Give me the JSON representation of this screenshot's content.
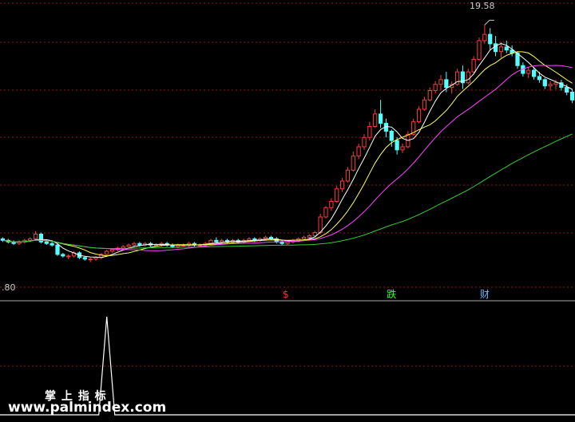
{
  "chart_data": {
    "type": "candlestick",
    "y_price_labels": {
      "low": ".80",
      "high": "19.58"
    },
    "ylim": [
      2.8,
      21.0
    ],
    "x_count": 120,
    "candles": [
      [
        5.9,
        6.0,
        5.7,
        5.8
      ],
      [
        5.8,
        5.9,
        5.6,
        5.7
      ],
      [
        5.7,
        5.8,
        5.5,
        5.6
      ],
      [
        5.6,
        5.8,
        5.5,
        5.7
      ],
      [
        5.7,
        5.9,
        5.6,
        5.8
      ],
      [
        5.8,
        6.0,
        5.7,
        5.9
      ],
      [
        5.9,
        6.4,
        5.8,
        6.2
      ],
      [
        6.2,
        6.3,
        5.6,
        5.7
      ],
      [
        5.7,
        5.8,
        5.5,
        5.6
      ],
      [
        5.6,
        5.8,
        5.4,
        5.5
      ],
      [
        5.5,
        5.6,
        4.8,
        4.9
      ],
      [
        4.9,
        5.0,
        4.7,
        4.8
      ],
      [
        4.8,
        4.9,
        4.6,
        4.8
      ],
      [
        4.8,
        5.1,
        4.7,
        5.0
      ],
      [
        5.0,
        5.1,
        4.6,
        4.7
      ],
      [
        4.7,
        4.8,
        4.5,
        4.6
      ],
      [
        4.6,
        4.7,
        4.4,
        4.6
      ],
      [
        4.6,
        4.8,
        4.5,
        4.7
      ],
      [
        4.7,
        5.0,
        4.6,
        4.9
      ],
      [
        4.9,
        5.2,
        4.8,
        5.1
      ],
      [
        5.1,
        5.3,
        5.0,
        5.2
      ],
      [
        5.2,
        5.4,
        5.1,
        5.3
      ],
      [
        5.3,
        5.5,
        5.2,
        5.4
      ],
      [
        5.4,
        5.6,
        5.3,
        5.5
      ],
      [
        5.5,
        5.7,
        5.4,
        5.6
      ],
      [
        5.6,
        5.7,
        5.4,
        5.5
      ],
      [
        5.5,
        5.7,
        5.4,
        5.6
      ],
      [
        5.6,
        5.7,
        5.4,
        5.5
      ],
      [
        5.5,
        5.6,
        5.4,
        5.5
      ],
      [
        5.5,
        5.7,
        5.4,
        5.6
      ],
      [
        5.6,
        5.7,
        5.4,
        5.5
      ],
      [
        5.5,
        5.6,
        5.3,
        5.4
      ],
      [
        5.4,
        5.6,
        5.3,
        5.5
      ],
      [
        5.5,
        5.6,
        5.4,
        5.5
      ],
      [
        5.5,
        5.7,
        5.4,
        5.6
      ],
      [
        5.6,
        5.7,
        5.4,
        5.5
      ],
      [
        5.5,
        5.6,
        5.4,
        5.5
      ],
      [
        5.5,
        5.7,
        5.4,
        5.6
      ],
      [
        5.6,
        5.9,
        5.5,
        5.8
      ],
      [
        5.8,
        6.0,
        5.6,
        5.7
      ],
      [
        5.7,
        5.9,
        5.6,
        5.8
      ],
      [
        5.8,
        5.9,
        5.6,
        5.7
      ],
      [
        5.7,
        5.9,
        5.6,
        5.8
      ],
      [
        5.8,
        5.9,
        5.6,
        5.7
      ],
      [
        5.7,
        5.9,
        5.6,
        5.8
      ],
      [
        5.8,
        6.0,
        5.7,
        5.9
      ],
      [
        5.9,
        6.0,
        5.7,
        5.8
      ],
      [
        5.8,
        6.0,
        5.7,
        5.9
      ],
      [
        5.9,
        6.1,
        5.8,
        6.0
      ],
      [
        6.0,
        6.1,
        5.8,
        5.9
      ],
      [
        5.9,
        6.0,
        5.6,
        5.7
      ],
      [
        5.7,
        5.8,
        5.5,
        5.6
      ],
      [
        5.6,
        5.8,
        5.5,
        5.7
      ],
      [
        5.7,
        5.9,
        5.6,
        5.8
      ],
      [
        5.8,
        6.0,
        5.7,
        5.9
      ],
      [
        5.9,
        6.1,
        5.8,
        6.0
      ],
      [
        6.0,
        6.2,
        5.9,
        6.1
      ],
      [
        6.1,
        6.4,
        6.0,
        6.3
      ],
      [
        6.3,
        7.5,
        6.2,
        7.3
      ],
      [
        7.3,
        8.0,
        7.2,
        7.9
      ],
      [
        7.9,
        8.5,
        7.7,
        8.3
      ],
      [
        8.3,
        9.3,
        8.2,
        9.1
      ],
      [
        9.1,
        9.8,
        8.9,
        9.6
      ],
      [
        9.6,
        10.5,
        9.5,
        10.3
      ],
      [
        10.3,
        11.5,
        10.2,
        11.2
      ],
      [
        11.2,
        12.0,
        11.0,
        11.8
      ],
      [
        11.8,
        12.6,
        11.6,
        12.4
      ],
      [
        12.4,
        13.4,
        12.2,
        13.1
      ],
      [
        13.1,
        14.2,
        13.0,
        13.9
      ],
      [
        13.9,
        14.8,
        13.0,
        13.3
      ],
      [
        13.3,
        13.6,
        12.4,
        12.8
      ],
      [
        12.8,
        12.9,
        11.8,
        12.2
      ],
      [
        12.2,
        12.4,
        11.3,
        11.6
      ],
      [
        11.6,
        12.0,
        11.4,
        11.8
      ],
      [
        11.8,
        12.8,
        11.7,
        12.6
      ],
      [
        12.6,
        13.6,
        12.5,
        13.4
      ],
      [
        13.4,
        14.4,
        13.3,
        14.2
      ],
      [
        14.2,
        15.0,
        14.1,
        14.8
      ],
      [
        14.8,
        15.6,
        14.7,
        15.4
      ],
      [
        15.4,
        16.0,
        15.2,
        15.8
      ],
      [
        15.8,
        16.4,
        15.4,
        16.1
      ],
      [
        16.1,
        16.6,
        15.3,
        15.6
      ],
      [
        15.6,
        16.0,
        15.2,
        15.8
      ],
      [
        15.8,
        16.8,
        15.7,
        16.6
      ],
      [
        16.6,
        17.0,
        15.5,
        15.9
      ],
      [
        15.9,
        16.8,
        15.8,
        16.6
      ],
      [
        16.6,
        17.6,
        16.5,
        17.4
      ],
      [
        17.4,
        18.8,
        17.3,
        18.6
      ],
      [
        18.6,
        19.6,
        18.4,
        19.0
      ],
      [
        19.0,
        19.4,
        18.0,
        18.4
      ],
      [
        18.4,
        18.9,
        17.6,
        17.9
      ],
      [
        17.9,
        18.5,
        17.5,
        18.2
      ],
      [
        18.2,
        18.6,
        17.8,
        18.0
      ],
      [
        18.0,
        18.3,
        17.6,
        17.8
      ],
      [
        17.8,
        17.9,
        16.8,
        17.0
      ],
      [
        17.0,
        17.2,
        16.3,
        16.5
      ],
      [
        16.5,
        16.9,
        16.2,
        16.7
      ],
      [
        16.7,
        16.9,
        16.1,
        16.3
      ],
      [
        16.3,
        16.6,
        15.9,
        16.1
      ],
      [
        16.1,
        16.2,
        15.5,
        15.7
      ],
      [
        15.7,
        16.0,
        15.4,
        15.8
      ],
      [
        15.8,
        16.1,
        15.5,
        15.9
      ],
      [
        15.9,
        16.1,
        15.4,
        15.6
      ],
      [
        15.6,
        15.8,
        15.1,
        15.3
      ],
      [
        15.3,
        15.5,
        14.6,
        14.8
      ]
    ],
    "indicator": {
      "values_max": 1,
      "spike_index": 19,
      "spike_value": 1
    },
    "bottom_labels": [
      {
        "text": "$",
        "color": "#ff3333",
        "index": 52
      },
      {
        "text": "跌",
        "color": "#33ff33",
        "index": 71
      },
      {
        "text": "财",
        "color": "#6fb8ff",
        "index": 88
      }
    ],
    "gridlines": true,
    "colors": {
      "up": "#ff3a3a",
      "down": "#54ffff",
      "ma_white": "#ffffff",
      "ma_yellow": "#ffff55",
      "ma_magenta": "#ff44ff",
      "ma_green": "#33cc33",
      "grid": "#8b1a1a",
      "divider": "#aaaaaa",
      "label": "#cccccc"
    }
  },
  "watermark": {
    "title": "掌 上 指 标",
    "url": "www.palmindex.com"
  }
}
